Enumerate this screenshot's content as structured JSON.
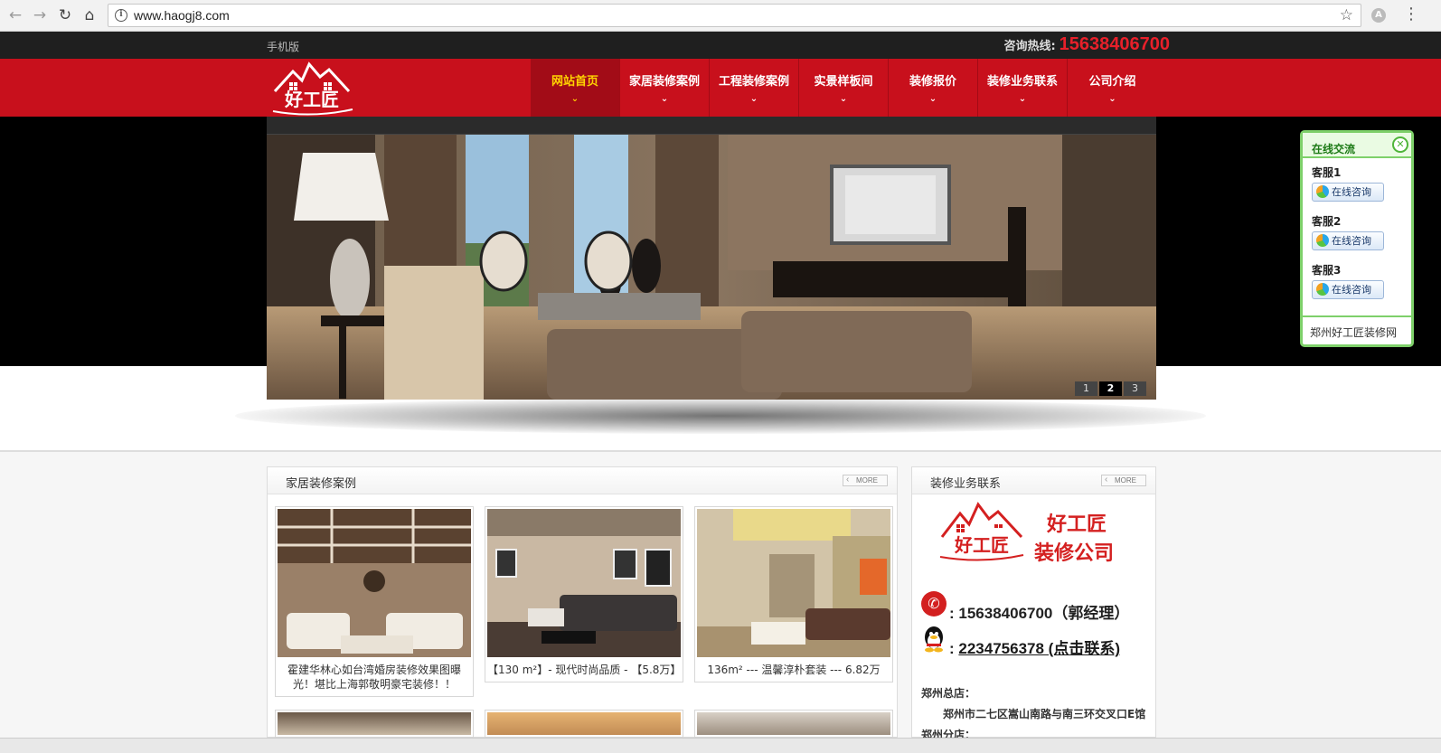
{
  "browser": {
    "url": "www.haogj8.com"
  },
  "topbar": {
    "mobile_link": "手机版",
    "hotline_label": "咨询热线:",
    "hotline_number": "15638406700"
  },
  "nav": {
    "items": [
      {
        "label": "网站首页",
        "active": true
      },
      {
        "label": "家居装修案例",
        "active": false
      },
      {
        "label": "工程装修案例",
        "active": false
      },
      {
        "label": "实景样板间",
        "active": false
      },
      {
        "label": "装修报价",
        "active": false
      },
      {
        "label": "装修业务联系",
        "active": false
      },
      {
        "label": "公司介绍",
        "active": false
      }
    ]
  },
  "banner": {
    "slides": [
      "1",
      "2",
      "3"
    ],
    "active_slide": "2"
  },
  "chat_widget": {
    "title": "在线交流",
    "agents": [
      {
        "label": "客服1",
        "button": "在线咨询"
      },
      {
        "label": "客服2",
        "button": "在线咨询"
      },
      {
        "label": "客服3",
        "button": "在线咨询"
      }
    ],
    "footer": "郑州好工匠装修网"
  },
  "cases_panel": {
    "title": "家居装修案例",
    "more": "MORE",
    "items": [
      {
        "caption": "霍建华林心如台湾婚房装修效果图曝光！堪比上海郭敬明豪宅装修！！"
      },
      {
        "caption": "【130 m²】- 现代时尚品质 - 【5.8万】"
      },
      {
        "caption": "136m² --- 温馨淳朴套装 --- 6.82万"
      }
    ]
  },
  "contact_panel": {
    "title": "装修业务联系",
    "more": "MORE",
    "logo_text_1": "好工匠",
    "logo_text_2": "装修公司",
    "phone": "15638406700（郭经理）",
    "qq": "2234756378 (点击联系)",
    "hq_label": "郑州总店：",
    "hq_address": "郑州市二七区嵩山南路与南三环交叉口E馆",
    "branch_label": "郑州分店："
  },
  "colors": {
    "brand_red": "#c8101c",
    "active_nav": "#ffd400",
    "chat_green": "#7ed06a"
  }
}
